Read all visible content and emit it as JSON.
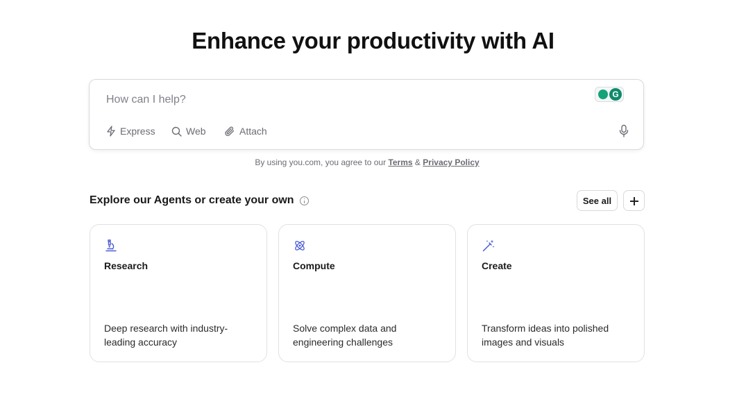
{
  "hero": {
    "title": "Enhance your productivity with AI"
  },
  "prompt": {
    "placeholder": "How can I help?",
    "tools": {
      "express_label": "Express",
      "web_label": "Web",
      "attach_label": "Attach"
    },
    "icons": {
      "express": "lightning-icon",
      "web": "search-icon",
      "attach": "paperclip-icon",
      "mic": "microphone-icon",
      "extension": "grammarly-badge-icon"
    },
    "extension_letter": "G"
  },
  "terms": {
    "prefix": "By using you.com, you agree to our",
    "terms_link": "Terms",
    "ampersand": "&",
    "privacy_link": "Privacy Policy"
  },
  "agents": {
    "heading": "Explore our Agents or create your own",
    "see_all_label": "See all",
    "cards": [
      {
        "title": "Research",
        "description": "Deep research with industry-leading accuracy",
        "icon": "microscope-icon"
      },
      {
        "title": "Compute",
        "description": "Solve complex data and engineering challenges",
        "icon": "atom-icon"
      },
      {
        "title": "Create",
        "description": "Transform ideas into polished images and visuals",
        "icon": "magic-wand-icon"
      }
    ]
  },
  "colors": {
    "accent": "#4a5bd4",
    "muted_text": "#6b6b73",
    "border": "#d9d9dc",
    "extension_green": "#0f8a6a"
  }
}
